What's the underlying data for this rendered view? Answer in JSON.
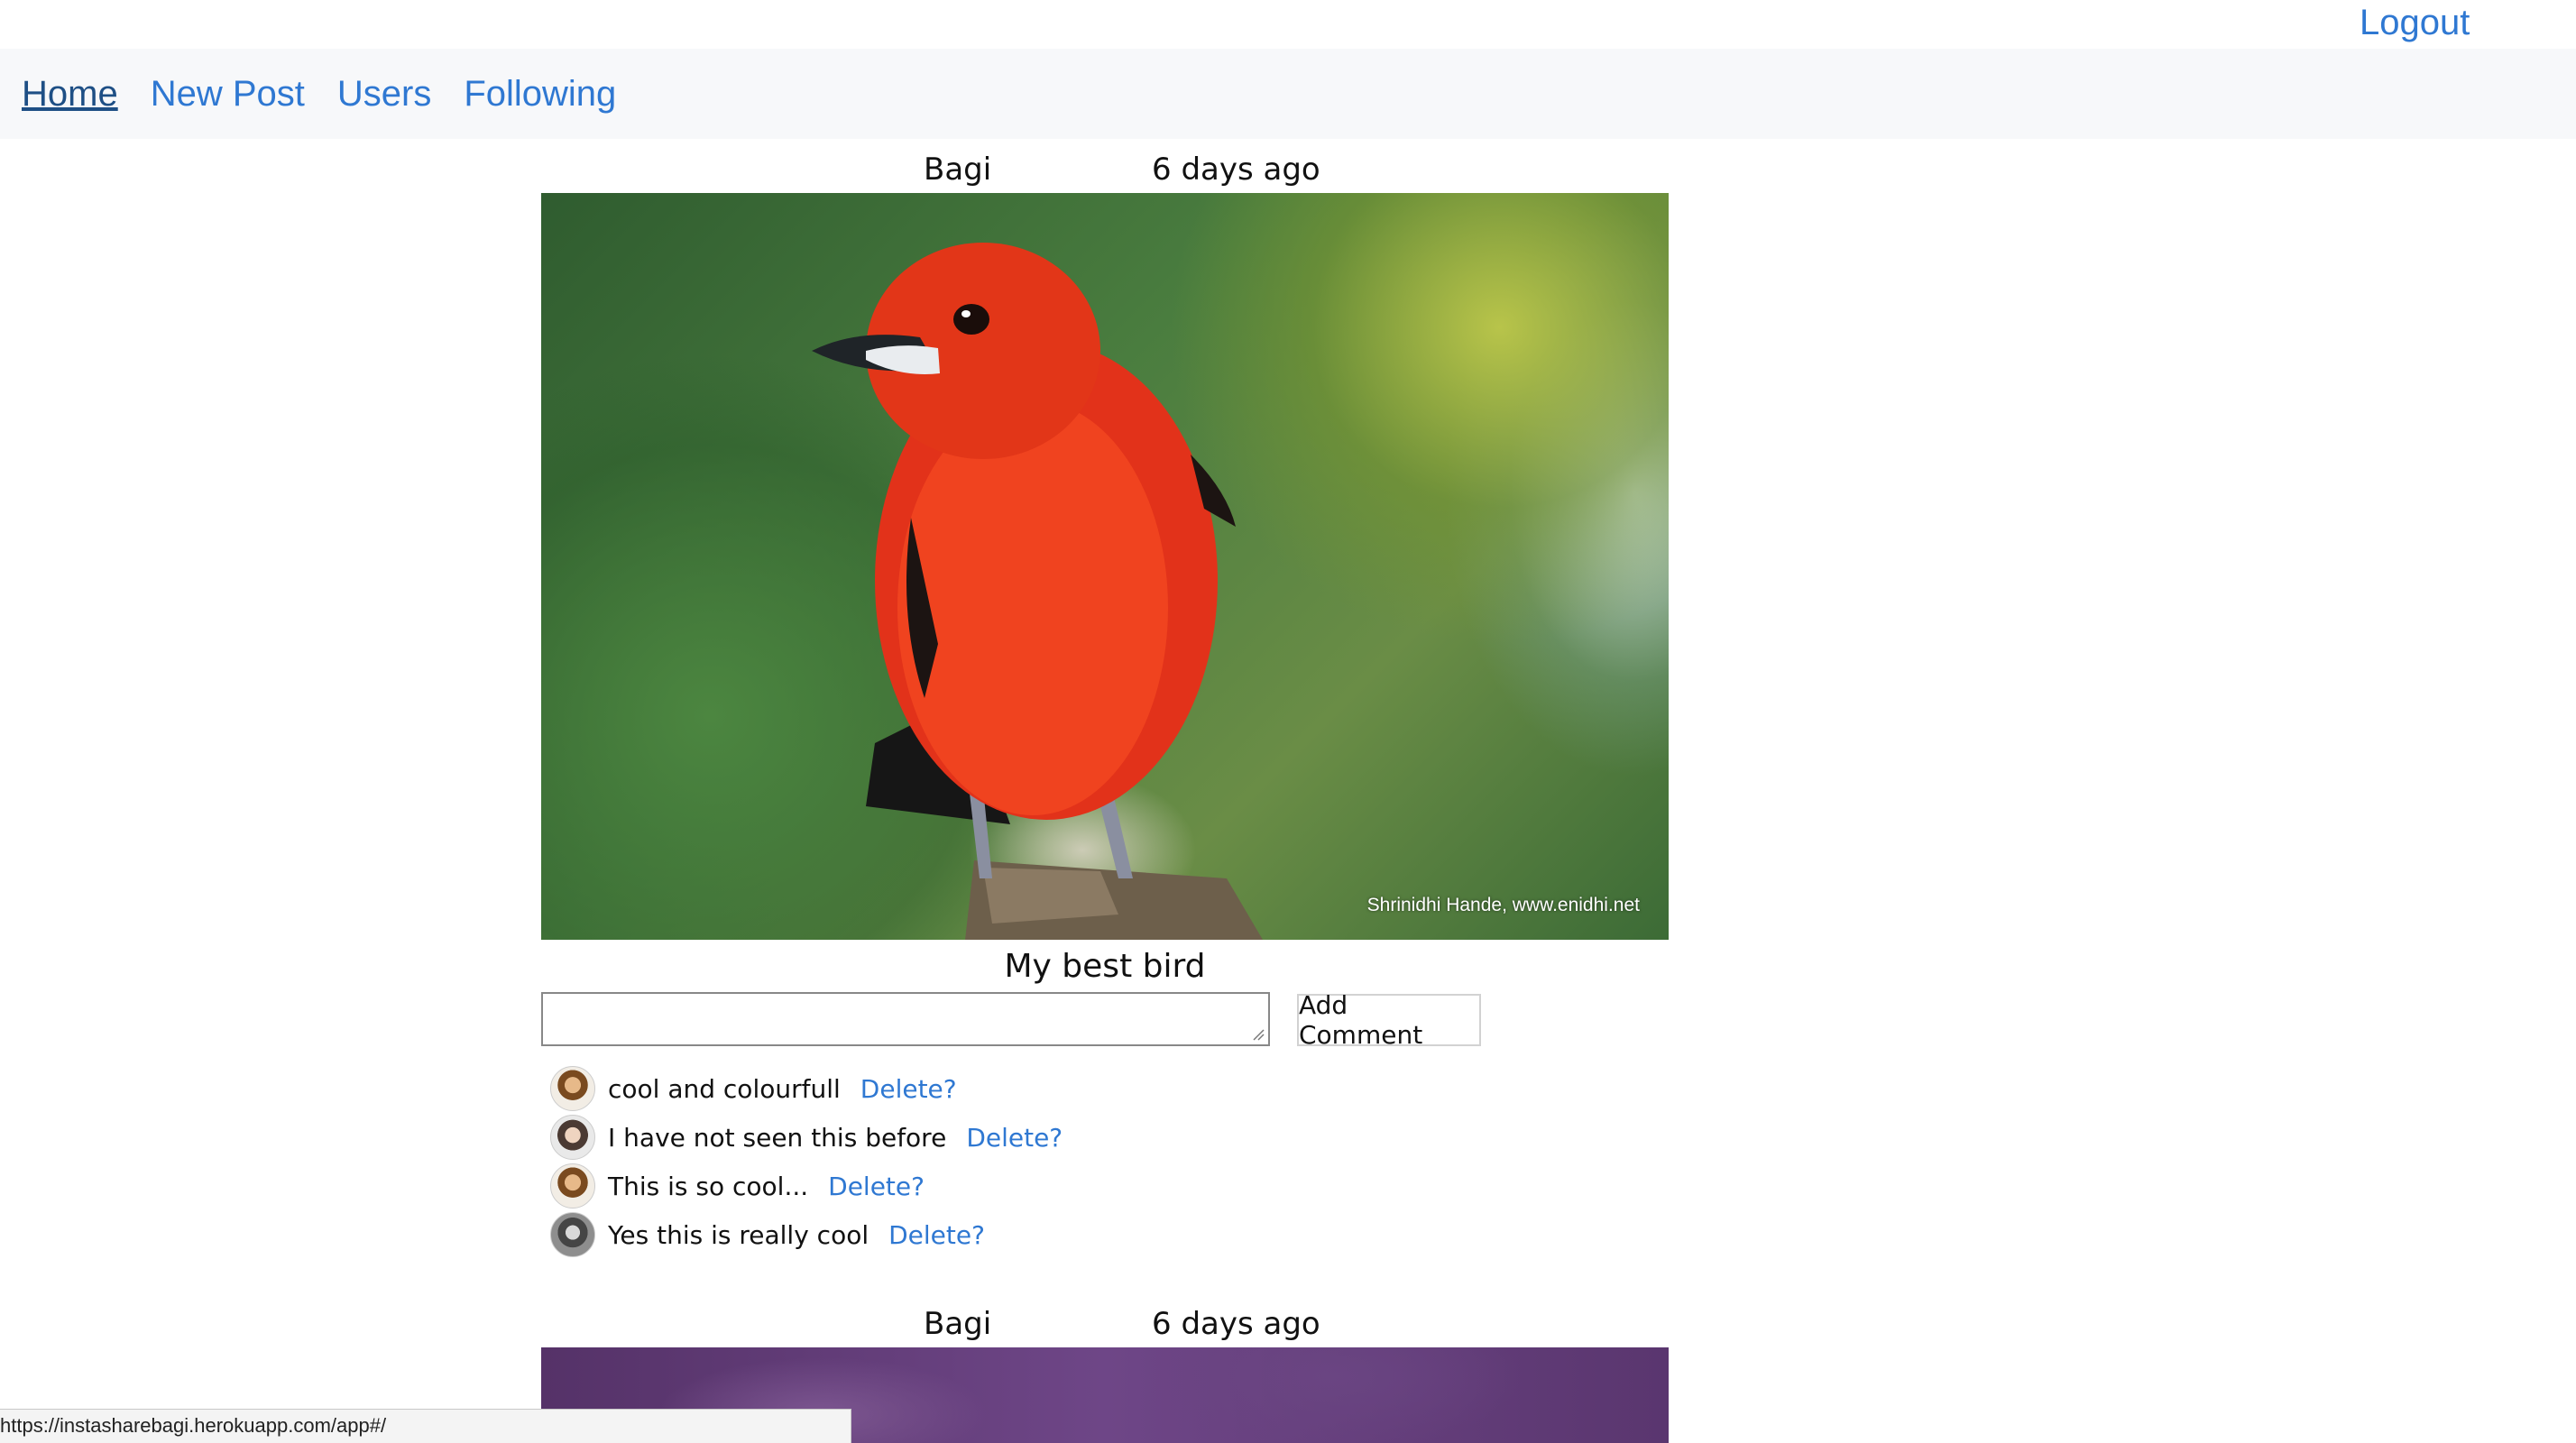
{
  "header": {
    "logout_label": "Logout"
  },
  "nav": {
    "items": [
      {
        "label": "Home",
        "active": true
      },
      {
        "label": "New Post"
      },
      {
        "label": "Users"
      },
      {
        "label": "Following"
      }
    ]
  },
  "posts": [
    {
      "author": "Bagi",
      "time": "6 days ago",
      "image_credit": "Shrinidhi Hande, www.enidhi.net",
      "caption": "My best bird",
      "comment_input": {
        "value": "",
        "placeholder": ""
      },
      "add_comment_label": "Add Comment",
      "comments": [
        {
          "text": "cool and colourfull",
          "delete_label": "Delete?"
        },
        {
          "text": "I have not seen this before",
          "delete_label": "Delete?"
        },
        {
          "text": "This is so cool...",
          "delete_label": "Delete?"
        },
        {
          "text": "Yes this is really cool",
          "delete_label": "Delete?"
        }
      ]
    },
    {
      "author": "Bagi",
      "time": "6 days ago"
    }
  ],
  "status_bar": {
    "url": "https://instasharebagi.herokuapp.com/app#/"
  },
  "colors": {
    "link": "#2f78d2",
    "navbar_bg": "#f7f8fa"
  }
}
